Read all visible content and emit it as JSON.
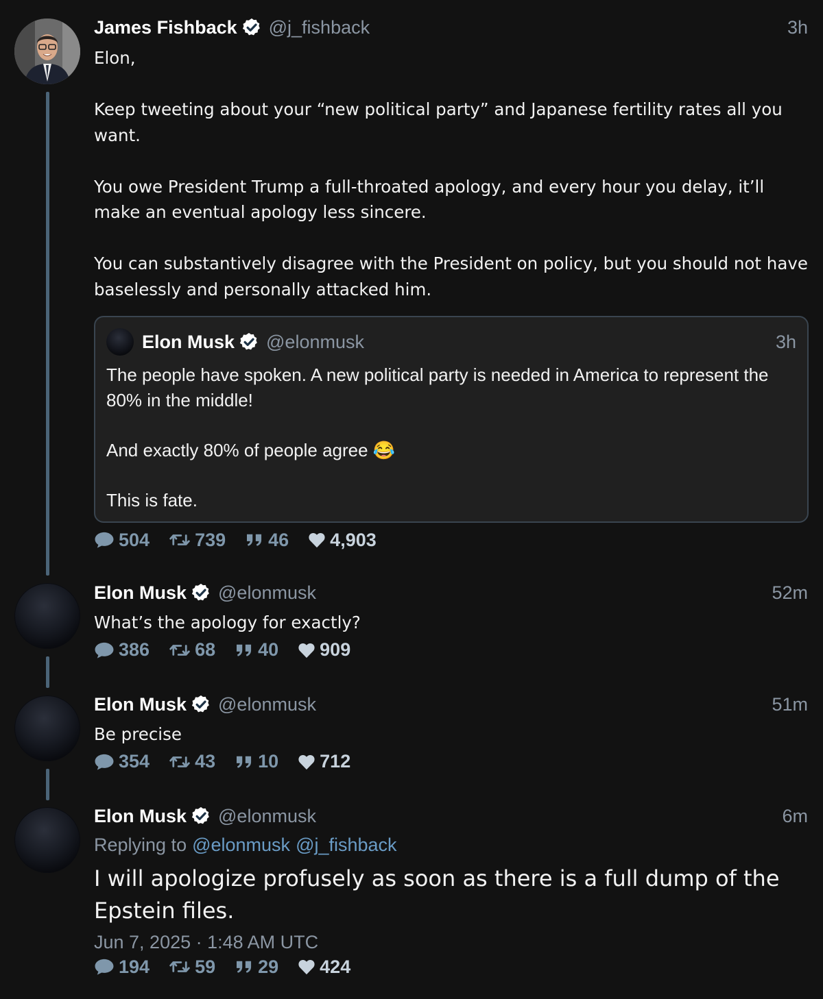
{
  "tweets": [
    {
      "name": "James Fishback",
      "handle": "@j_fishback",
      "time": "3h",
      "text": "Elon,\n\nKeep tweeting about your “new political party” and Japanese fertility rates all you want.\n\nYou owe President Trump a full-throated apology, and every hour you delay, it’ll make an eventual apology less sincere.\n\nYou can substantively disagree with the President on policy, but you should not have baselessly and personally attacked him.",
      "quote": {
        "name": "Elon Musk",
        "handle": "@elonmusk",
        "time": "3h",
        "text": "The people have spoken. A new political party is needed in America to represent the 80% in the middle!\n\nAnd exactly 80% of people agree 😂\n\nThis is fate."
      },
      "stats": {
        "replies": "504",
        "retweets": "739",
        "quotes": "46",
        "likes": "4,903"
      }
    },
    {
      "name": "Elon Musk",
      "handle": "@elonmusk",
      "time": "52m",
      "text": "What’s the apology for exactly?",
      "stats": {
        "replies": "386",
        "retweets": "68",
        "quotes": "40",
        "likes": "909"
      }
    },
    {
      "name": "Elon Musk",
      "handle": "@elonmusk",
      "time": "51m",
      "text": "Be precise",
      "stats": {
        "replies": "354",
        "retweets": "43",
        "quotes": "10",
        "likes": "712"
      }
    },
    {
      "name": "Elon Musk",
      "handle": "@elonmusk",
      "time": "6m",
      "replying_label": "Replying to",
      "replying_to": [
        "@elonmusk",
        "@j_fishback"
      ],
      "text": "I will apologize profusely as soon as there is a full dump of the Epstein files.",
      "datetime": "Jun 7, 2025 · 1:48 AM UTC",
      "stats": {
        "replies": "194",
        "retweets": "59",
        "quotes": "29",
        "likes": "424"
      }
    }
  ],
  "icons": {
    "verified": "verified-badge-icon",
    "reply": "reply-bubble-icon",
    "retweet": "retweet-icon",
    "quote": "quote-icon",
    "like": "heart-icon"
  },
  "colors": {
    "background": "#121212",
    "stat_blue": "#7f97ab",
    "thread_line": "#4b6478",
    "mention": "#6a9cc6"
  }
}
